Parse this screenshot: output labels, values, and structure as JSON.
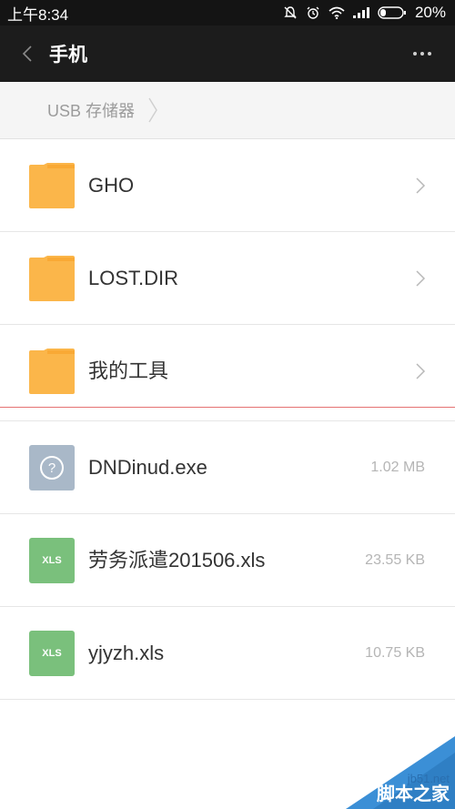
{
  "status_bar": {
    "time": "上午8:34",
    "battery": "20%"
  },
  "app_bar": {
    "title": "手机"
  },
  "breadcrumb": {
    "crumb": "USB 存储器"
  },
  "folders": [
    {
      "name": "GHO"
    },
    {
      "name": "LOST.DIR"
    },
    {
      "name": "我的工具"
    }
  ],
  "files": [
    {
      "name": "DNDinud.exe",
      "size": "1.02 MB",
      "type": "unknown",
      "icon_label": "?"
    },
    {
      "name": "劳务派遣201506.xls",
      "size": "23.55 KB",
      "type": "xls",
      "icon_label": "XLS"
    },
    {
      "name": "yjyzh.xls",
      "size": "10.75 KB",
      "type": "xls",
      "icon_label": "XLS"
    }
  ],
  "watermark": {
    "site": "jb51.net",
    "brand": "脚本之家"
  },
  "colors": {
    "folder": "#fbb64a",
    "xls": "#7ac07c",
    "unknown": "#a9b8c8",
    "divider": "#e57272"
  }
}
